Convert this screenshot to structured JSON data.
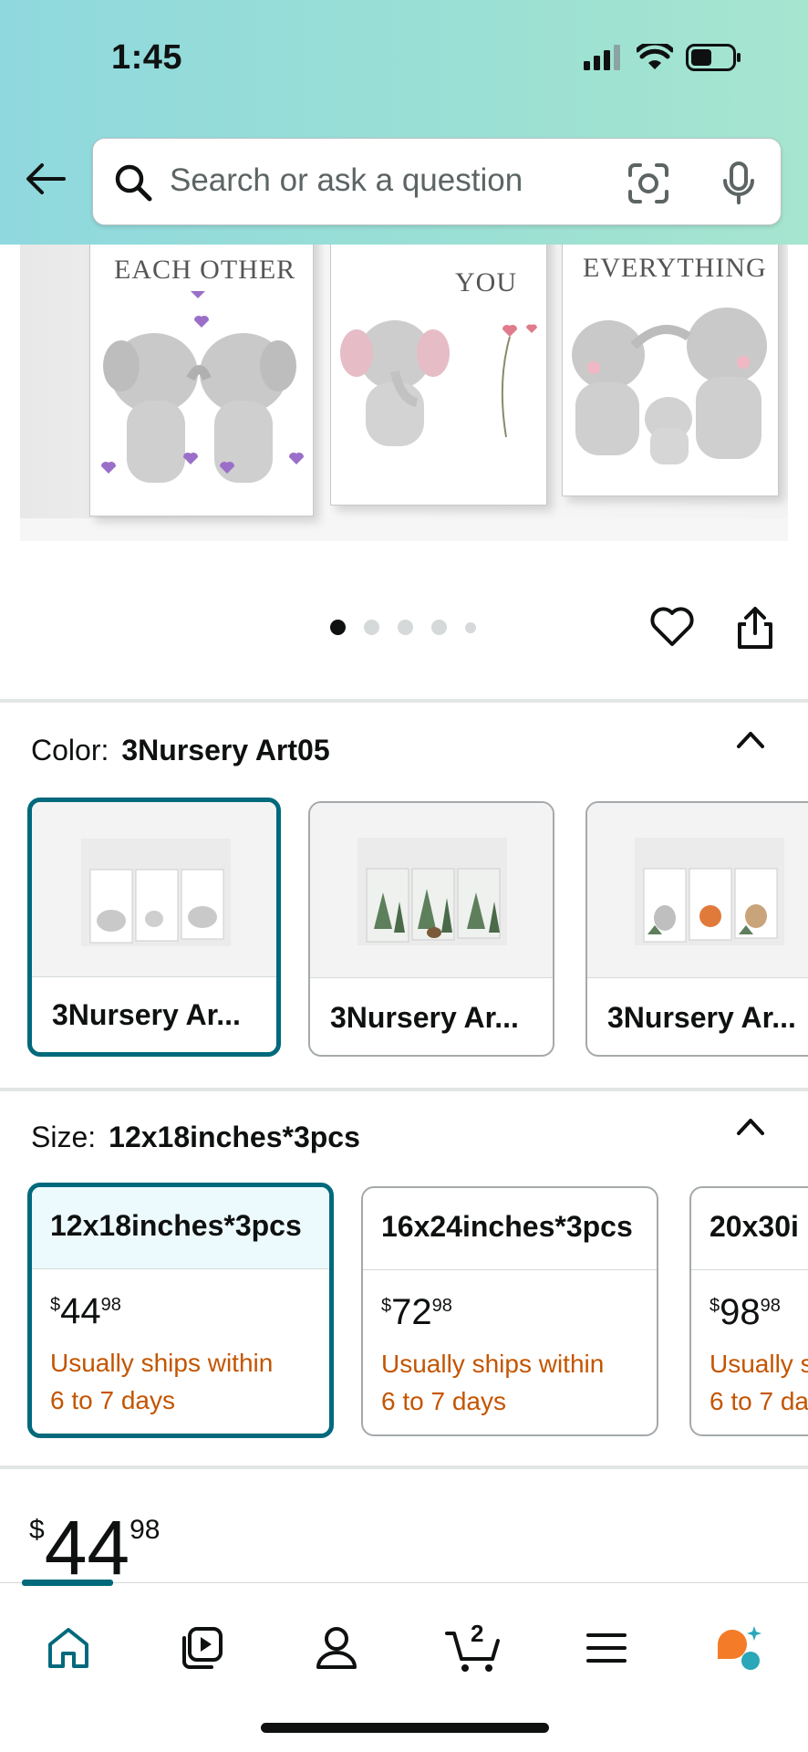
{
  "status_bar": {
    "time": "1:45"
  },
  "search": {
    "placeholder": "Search or ask a question"
  },
  "product_image": {
    "canvas_texts": [
      "EACH OTHER",
      "YOU",
      "EVERYTHING"
    ]
  },
  "carousel": {
    "total_dots": 5,
    "active_index": 0
  },
  "color_section": {
    "label": "Color:",
    "selected_value": "3Nursery Art05",
    "options": [
      {
        "label": "3Nursery Ar...",
        "selected": true
      },
      {
        "label": "3Nursery Ar...",
        "selected": false
      },
      {
        "label": "3Nursery Ar...",
        "selected": false
      }
    ]
  },
  "size_section": {
    "label": "Size:",
    "selected_value": "12x18inches*3pcs",
    "options": [
      {
        "title": "12x18inches*3pcs",
        "price_whole": "44",
        "price_cents": "98",
        "ship_line1": "Usually ships within",
        "ship_line2": "6 to 7 days",
        "selected": true
      },
      {
        "title": "16x24inches*3pcs",
        "price_whole": "72",
        "price_cents": "98",
        "ship_line1": "Usually ships within",
        "ship_line2": "6 to 7 days",
        "selected": false
      },
      {
        "title": "20x30i",
        "price_whole": "98",
        "price_cents": "98",
        "ship_line1": "Usually s",
        "ship_line2": "6 to 7 da",
        "selected": false
      }
    ]
  },
  "price": {
    "currency": "$",
    "whole": "44",
    "cents": "98"
  },
  "bottom_nav": {
    "items": [
      "home-icon",
      "video-icon",
      "account-icon",
      "cart-icon",
      "menu-icon",
      "rufus-icon"
    ],
    "cart_count": "2",
    "active": "home-icon"
  },
  "colors": {
    "accent": "#00697c",
    "shipping": "#c45500",
    "text": "#0f1111"
  }
}
